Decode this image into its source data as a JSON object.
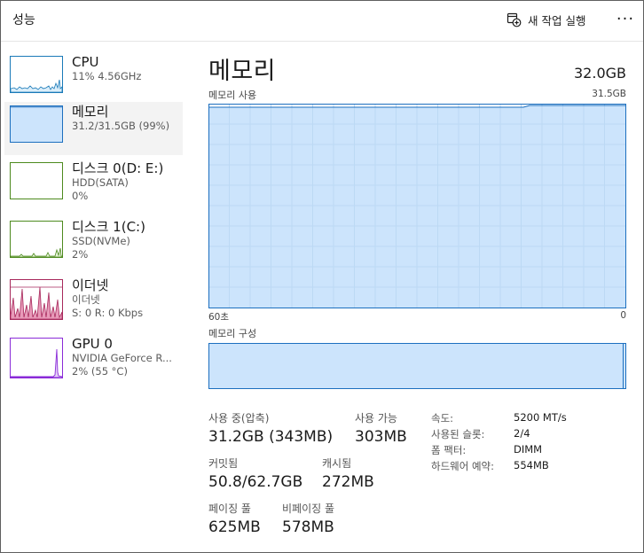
{
  "header": {
    "title": "성능",
    "run_task_label": "새 작업 실행",
    "more_label": "···"
  },
  "colors": {
    "memory_fill": "#cce4fc",
    "memory_line": "#1c6fbf",
    "cpu_line": "#1a7ab8",
    "disk_line": "#4d8a1e",
    "net_line": "#a7285b",
    "gpu_line": "#8a2bd8"
  },
  "sidebar": {
    "items": [
      {
        "name": "CPU",
        "sub1": "11% 4.56GHz",
        "sub2": "",
        "sub3": ""
      },
      {
        "name": "메모리",
        "sub1": "31.2/31.5GB (99%)",
        "sub2": "",
        "sub3": ""
      },
      {
        "name": "디스크 0(D: E:)",
        "sub1": "HDD(SATA)",
        "sub2": "0%",
        "sub3": ""
      },
      {
        "name": "디스크 1(C:)",
        "sub1": "SSD(NVMe)",
        "sub2": "2%",
        "sub3": ""
      },
      {
        "name": "이더넷",
        "sub1": "이더넷",
        "sub2": "S: 0 R: 0 Kbps",
        "sub3": ""
      },
      {
        "name": "GPU 0",
        "sub1": "NVIDIA GeForce R...",
        "sub2": "2% (55 °C)",
        "sub3": ""
      }
    ]
  },
  "main": {
    "title": "메모리",
    "total": "32.0GB",
    "usage_label": "메모리 사용",
    "usage_max": "31.5GB",
    "axis_left": "60초",
    "axis_right": "0",
    "composition_label": "메모리 구성",
    "usage_fraction": 0.99
  },
  "stats": {
    "in_use_label": "사용 중(압축)",
    "in_use_value": "31.2GB (343MB)",
    "available_label": "사용 가능",
    "available_value": "303MB",
    "committed_label": "커밋됨",
    "committed_value": "50.8/62.7GB",
    "cached_label": "캐시됨",
    "cached_value": "272MB",
    "paged_label": "페이징 풀",
    "paged_value": "625MB",
    "nonpaged_label": "비페이징 풀",
    "nonpaged_value": "578MB"
  },
  "details": {
    "speed_key": "속도:",
    "speed_val": "5200 MT/s",
    "slots_key": "사용된 슬롯:",
    "slots_val": "2/4",
    "form_key": "폼 팩터:",
    "form_val": "DIMM",
    "reserved_key": "하드웨어 예약:",
    "reserved_val": "554MB"
  }
}
